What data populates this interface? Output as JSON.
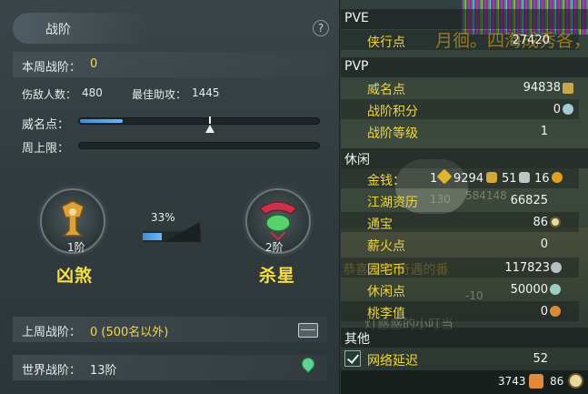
{
  "panel": {
    "title": "战阶",
    "help": "?",
    "week_rank_label": "本周战阶：",
    "week_rank_value": "0",
    "injured_label": "伤敌人数：",
    "injured_value": "480",
    "best_assist_label": "最佳助攻：",
    "best_assist_value": "1445",
    "fame_label": "威名点：",
    "fame_progress": 0.18,
    "week_cap_label": "周上限：",
    "current_rank": {
      "level": "1阶",
      "name": "凶煞"
    },
    "progress_percent": "33%",
    "progress_fraction": 0.33,
    "next_rank": {
      "level": "2阶",
      "name": "杀星"
    },
    "last_week_label": "上周战阶：",
    "last_week_value": "0 (500名以外)",
    "world_rank_label": "世界战阶：",
    "world_rank_value": "13阶"
  },
  "stats": {
    "pve": {
      "header": "PVE",
      "items": [
        {
          "label": "侠行点",
          "value": "27420"
        }
      ]
    },
    "pvp": {
      "header": "PVP",
      "items": [
        {
          "label": "威名点",
          "value": "94838"
        },
        {
          "label": "战阶积分",
          "value": "0"
        },
        {
          "label": "战阶等级",
          "value": "1"
        }
      ]
    },
    "leisure": {
      "header": "休闲",
      "money_label": "金钱：",
      "money_parts": [
        "1",
        "9294",
        "51",
        "16"
      ],
      "items": [
        {
          "label": "江湖资历",
          "value": "66825"
        },
        {
          "label": "通宝",
          "value": "86"
        },
        {
          "label": "薪火点",
          "value": "0"
        },
        {
          "label": "园宅币",
          "value": "117823"
        },
        {
          "label": "休闲点",
          "value": "50000"
        },
        {
          "label": "桃李值",
          "value": "0"
        }
      ]
    },
    "other": {
      "header": "其他",
      "items": [
        {
          "label": "网络延迟",
          "value": "52"
        }
      ]
    },
    "footer": {
      "left_value": "3743",
      "right_value": "86"
    }
  },
  "background_text": {
    "top_right": "月徊。四海成秀各，",
    "chat_a": "恭喜 鲤拨奇遇的番",
    "chat_b": "灯惑惑的小叮当",
    "num_a": "130",
    "num_b": "584148",
    "num_c": "-10"
  },
  "colors": {
    "accent_yellow": "#f2d84a",
    "progress_blue": "#4a9fe6",
    "label_gold": "#f0d63a"
  }
}
